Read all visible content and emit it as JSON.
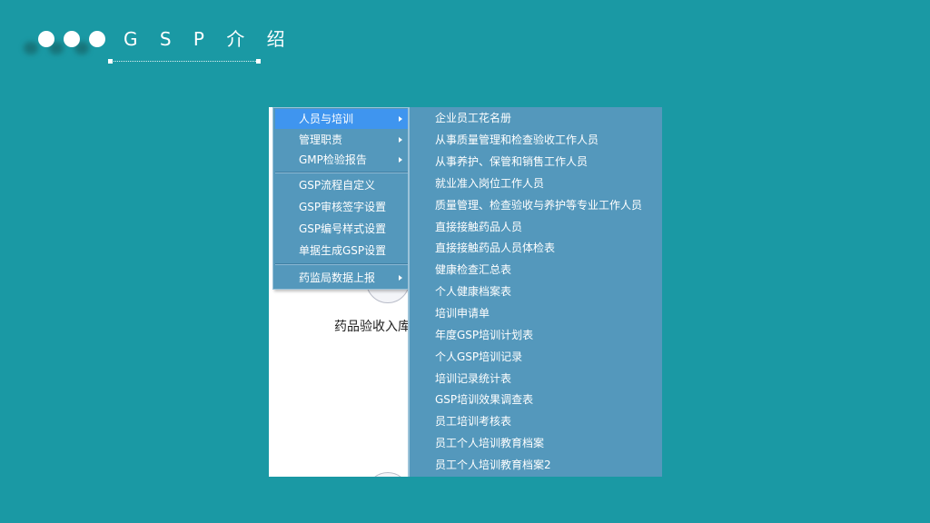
{
  "slide": {
    "title": "G S P 介 绍"
  },
  "background": {
    "label": "药品验收入库"
  },
  "menu": {
    "items": [
      {
        "label": "人员与培训",
        "has_submenu": true,
        "selected": true
      },
      {
        "label": "管理职责",
        "has_submenu": true,
        "selected": false
      },
      {
        "label": "GMP检验报告",
        "has_submenu": true,
        "selected": false
      },
      {
        "label": "GSP流程自定义",
        "has_submenu": false,
        "selected": false
      },
      {
        "label": "GSP审核签字设置",
        "has_submenu": false,
        "selected": false
      },
      {
        "label": "GSP编号样式设置",
        "has_submenu": false,
        "selected": false
      },
      {
        "label": "单据生成GSP设置",
        "has_submenu": false,
        "selected": false
      },
      {
        "label": "药监局数据上报",
        "has_submenu": true,
        "selected": false
      }
    ]
  },
  "submenu": {
    "items": [
      "企业员工花名册",
      "从事质量管理和检查验收工作人员",
      "从事养护、保管和销售工作人员",
      "就业准入岗位工作人员",
      "质量管理、检查验收与养护等专业工作人员",
      "直接接触药品人员",
      "直接接触药品人员体检表",
      "健康检查汇总表",
      "个人健康档案表",
      "培训申请单",
      "年度GSP培训计划表",
      "个人GSP培训记录",
      "培训记录统计表",
      "GSP培训效果调查表",
      "员工培训考核表",
      "员工个人培训教育档案",
      "员工个人培训教育档案2"
    ]
  },
  "colors": {
    "slide_background": "#1a99a4",
    "menu_background": "#5498bc",
    "menu_selected": "#3f95ef"
  }
}
